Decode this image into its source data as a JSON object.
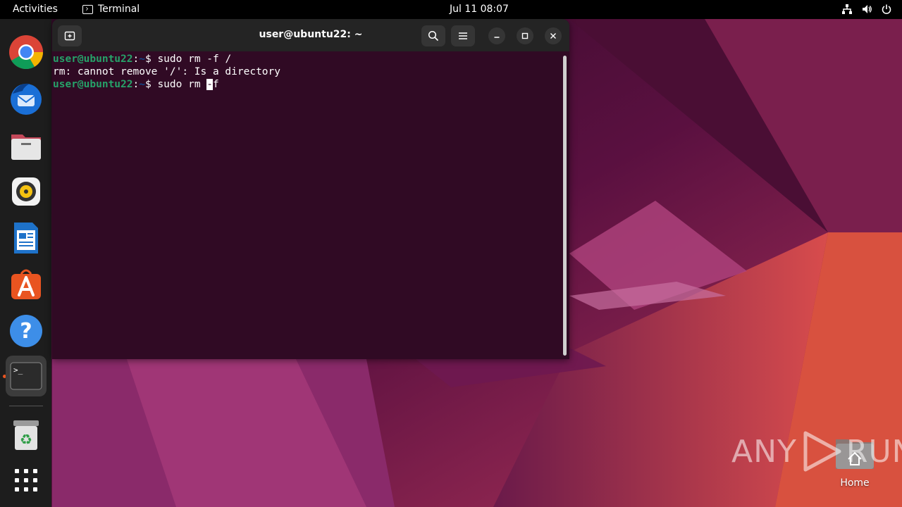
{
  "topbar": {
    "activities": "Activities",
    "app_name": "Terminal",
    "clock": "Jul 11  08:07"
  },
  "dock": {
    "items": [
      {
        "name": "Google Chrome",
        "icon": "chrome-icon"
      },
      {
        "name": "Thunderbird Mail",
        "icon": "thunderbird-icon"
      },
      {
        "name": "Files",
        "icon": "files-icon"
      },
      {
        "name": "Rhythmbox",
        "icon": "rhythmbox-icon"
      },
      {
        "name": "LibreOffice Writer",
        "icon": "writer-icon"
      },
      {
        "name": "Ubuntu Software",
        "icon": "software-icon"
      },
      {
        "name": "Help",
        "icon": "help-icon"
      },
      {
        "name": "Terminal",
        "icon": "terminal-icon",
        "active": true
      },
      {
        "name": "Trash",
        "icon": "trash-icon"
      },
      {
        "name": "Show Applications",
        "icon": "app-grid-icon"
      }
    ]
  },
  "terminal": {
    "title": "user@ubuntu22: ~",
    "lines": [
      {
        "user": "user@ubuntu22",
        "sep": ":",
        "path": "~",
        "dollar": "$ ",
        "cmd": "sudo rm -f /"
      },
      {
        "output": "rm: cannot remove '/': Is a directory"
      },
      {
        "user": "user@ubuntu22",
        "sep": ":",
        "path": "~",
        "dollar": "$ ",
        "cmd_before_cursor": "sudo rm ",
        "cursor_char": "-",
        "cmd_after_cursor": "f"
      }
    ]
  },
  "desktop": {
    "home_label": "Home"
  },
  "watermark": {
    "left": "ANY",
    "right": "RUN"
  },
  "colors": {
    "terminal_bg": "#300a24",
    "prompt_user": "#26a269",
    "prompt_path": "#12488b",
    "accent": "#e95420"
  }
}
